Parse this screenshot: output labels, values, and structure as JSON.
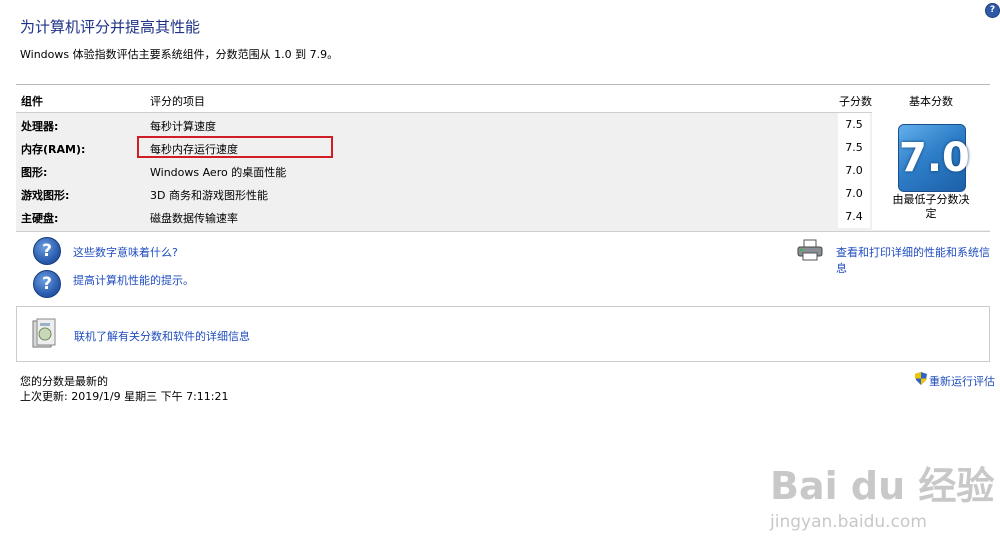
{
  "header": {
    "title": "为计算机评分并提高其性能",
    "subtitle": "Windows 体验指数评估主要系统组件，分数范围从 1.0 到 7.9。",
    "help_glyph": "?"
  },
  "table": {
    "col_component": "组件",
    "col_item": "评分的项目",
    "col_subscore": "子分数",
    "col_base": "基本分数",
    "rows": [
      {
        "component": "处理器:",
        "item": "每秒计算速度",
        "score": "7.5"
      },
      {
        "component": "内存(RAM):",
        "item": "每秒内存运行速度",
        "score": "7.5"
      },
      {
        "component": "图形:",
        "item": "Windows Aero 的桌面性能",
        "score": "7.0"
      },
      {
        "component": "游戏图形:",
        "item": "3D 商务和游戏图形性能",
        "score": "7.0"
      },
      {
        "component": "主硬盘:",
        "item": "磁盘数据传输速率",
        "score": "7.4"
      }
    ],
    "base_score": "7.0",
    "base_caption_line1": "由最低子分数决",
    "base_caption_line2": "定"
  },
  "links": {
    "what_numbers_mean": "这些数字意味着什么?",
    "improve_tips": "提高计算机性能的提示。",
    "view_print": "查看和打印详细的性能和系统信息",
    "online_info": "联机了解有关分数和软件的详细信息"
  },
  "footer": {
    "status": "您的分数是最新的",
    "last_update": "上次更新: 2019/1/9 星期三 下午 7:11:21",
    "rerun": "重新运行评估"
  },
  "watermark": {
    "logo": "Bai du 经验",
    "url": "jingyan.baidu.com"
  },
  "colors": {
    "title": "#1e3287",
    "link": "#1f4dbf",
    "highlight": "#d01e27",
    "badge": "#2f7fc9"
  }
}
